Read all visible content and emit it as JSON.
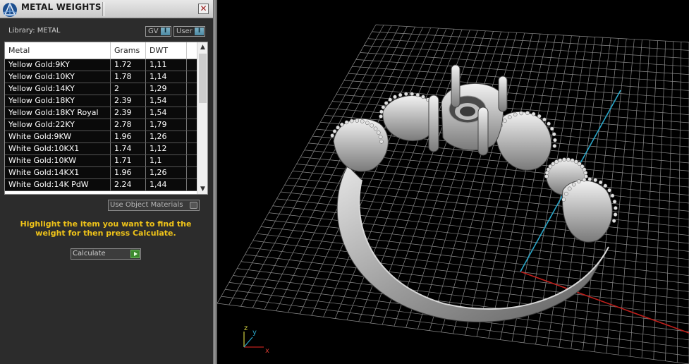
{
  "window": {
    "title": "METAL WEIGHTS",
    "close_label": "✕",
    "logo_icon": "rhino-gold-logo-icon"
  },
  "library": {
    "label": "Library: METAL",
    "gv_toggle": "GV",
    "user_toggle": "User"
  },
  "table": {
    "columns": [
      "Metal",
      "Grams",
      "DWT"
    ],
    "rows": [
      [
        "Yellow Gold:9KY",
        "1.72",
        "1,11"
      ],
      [
        "Yellow Gold:10KY",
        "1.78",
        "1,14"
      ],
      [
        "Yellow Gold:14KY",
        "2",
        "1,29"
      ],
      [
        "Yellow Gold:18KY",
        "2.39",
        "1,54"
      ],
      [
        "Yellow Gold:18KY Royal",
        "2.39",
        "1,54"
      ],
      [
        "Yellow Gold:22KY",
        "2.78",
        "1,79"
      ],
      [
        "White Gold:9KW",
        "1.96",
        "1,26"
      ],
      [
        "White Gold:10KX1",
        "1.74",
        "1,12"
      ],
      [
        "White Gold:10KW",
        "1.71",
        "1,1"
      ],
      [
        "White Gold:14KX1",
        "1.96",
        "1,26"
      ],
      [
        "White Gold:14K PdW",
        "2.24",
        "1,44"
      ]
    ],
    "scroll_up": "▲",
    "scroll_down": "▼"
  },
  "use_object_materials": "Use Object Materials",
  "hint": "Highlight the item you want to find the weight for then press Calculate.",
  "calculate_label": "Calculate",
  "viewport": {
    "axes": {
      "x": "x",
      "y": "y",
      "z": "z"
    },
    "colors": {
      "grid": "#8a8a8a",
      "x_axis": "#c0201c",
      "y_axis": "#2aa6c8",
      "ring": "#b9b9b9"
    }
  }
}
